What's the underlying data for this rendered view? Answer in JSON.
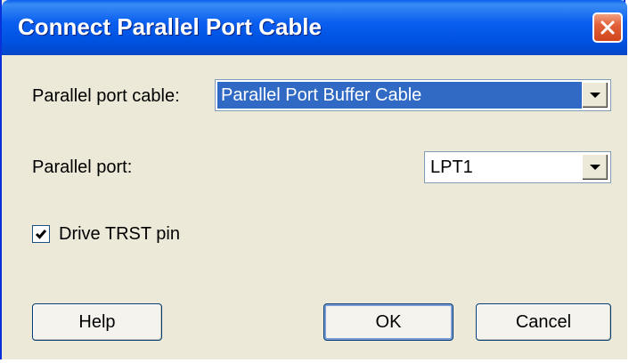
{
  "window": {
    "title": "Connect Parallel Port Cable"
  },
  "form": {
    "cable_label": "Parallel port cable:",
    "cable_value": "Parallel Port Buffer Cable",
    "port_label": "Parallel port:",
    "port_value": "LPT1",
    "trst_label": "Drive TRST pin",
    "trst_checked": true
  },
  "buttons": {
    "help": "Help",
    "ok": "OK",
    "cancel": "Cancel"
  },
  "icons": {
    "close": "close-icon",
    "dropdown": "chevron-down-icon",
    "check": "checkmark-icon"
  },
  "colors": {
    "titlebar": "#0a5ff0",
    "selection": "#316ac5",
    "close": "#d0441c"
  }
}
